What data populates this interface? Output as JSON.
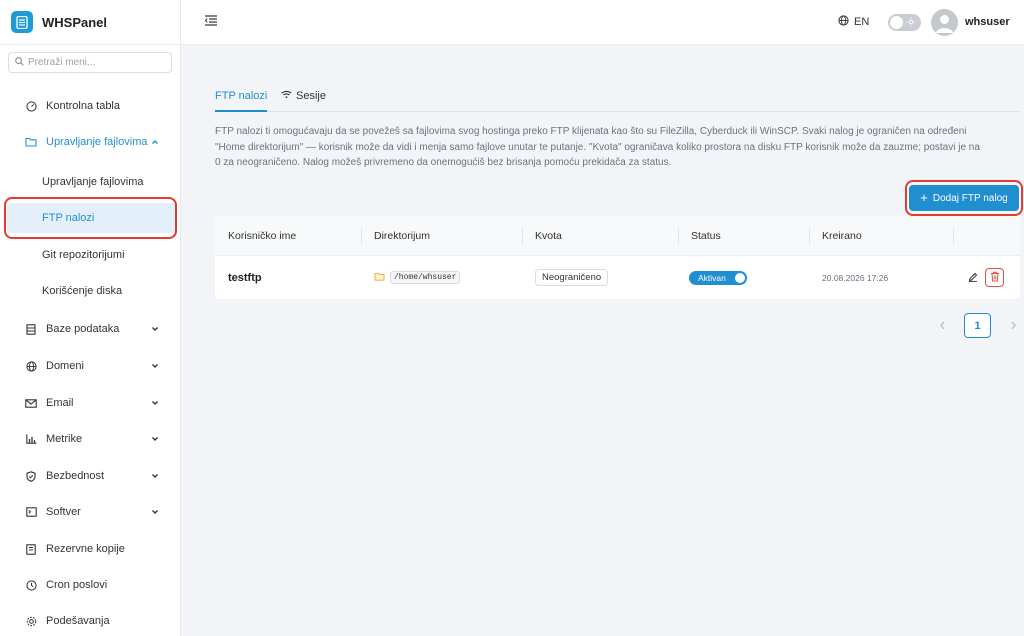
{
  "app": {
    "name": "WHSPanel"
  },
  "sidebar": {
    "search_placeholder": "Pretraži meni...",
    "items": [
      {
        "label": "Kontrolna tabla",
        "icon": "dashboard-icon"
      },
      {
        "label": "Upravljanje fajlovima",
        "icon": "folder-icon",
        "expanded": true
      },
      {
        "label": "Baze podataka",
        "icon": "database-icon"
      },
      {
        "label": "Domeni",
        "icon": "globe-icon"
      },
      {
        "label": "Email",
        "icon": "mail-icon"
      },
      {
        "label": "Metrike",
        "icon": "chart-icon"
      },
      {
        "label": "Bezbednost",
        "icon": "shield-icon"
      },
      {
        "label": "Softver",
        "icon": "terminal-icon"
      },
      {
        "label": "Rezervne kopije",
        "icon": "backup-icon"
      },
      {
        "label": "Cron poslovi",
        "icon": "clock-icon"
      },
      {
        "label": "Podešavanja",
        "icon": "gear-icon"
      }
    ],
    "sub_items": [
      {
        "label": "Upravljanje fajlovima"
      },
      {
        "label": "FTP nalozi",
        "active": true
      },
      {
        "label": "Git repozitorijumi"
      },
      {
        "label": "Korišćenje diska"
      }
    ]
  },
  "topbar": {
    "language": "EN",
    "username": "whsuser"
  },
  "tabs": [
    {
      "label": "FTP nalozi",
      "active": true
    },
    {
      "label": "Sesije"
    }
  ],
  "description": "FTP nalozi ti omogućavaju da se povežeš sa fajlovima svog hostinga preko FTP klijenata kao što su FileZilla, Cyberduck ili WinSCP. Svaki nalog je ograničen na određeni \"Home direktorijum\" — korisnik može da vidi i menja samo fajlove unutar te putanje. \"Kvota\" ograničava koliko prostora na disku FTP korisnik može da zauzme; postavi je na 0 za neograničeno. Nalog možeš privremeno da onemogućiš bez brisanja pomoću prekidača za status.",
  "add_button": {
    "label": "Dodaj FTP nalog",
    "plus": "+"
  },
  "table": {
    "headers": [
      "Korisničko ime",
      "Direktorijum",
      "Kvota",
      "Status",
      "Kreirano"
    ],
    "rows": [
      {
        "username": "testftp",
        "directory": "/home/whsuser",
        "quota": "Neograničeno",
        "status": "Aktivan",
        "created": "20.08.2026 17:26"
      }
    ]
  },
  "pagination": {
    "current": "1"
  },
  "colors": {
    "accent": "#1f8fd0",
    "highlight": "#e33b2e",
    "danger": "#e44d42"
  }
}
